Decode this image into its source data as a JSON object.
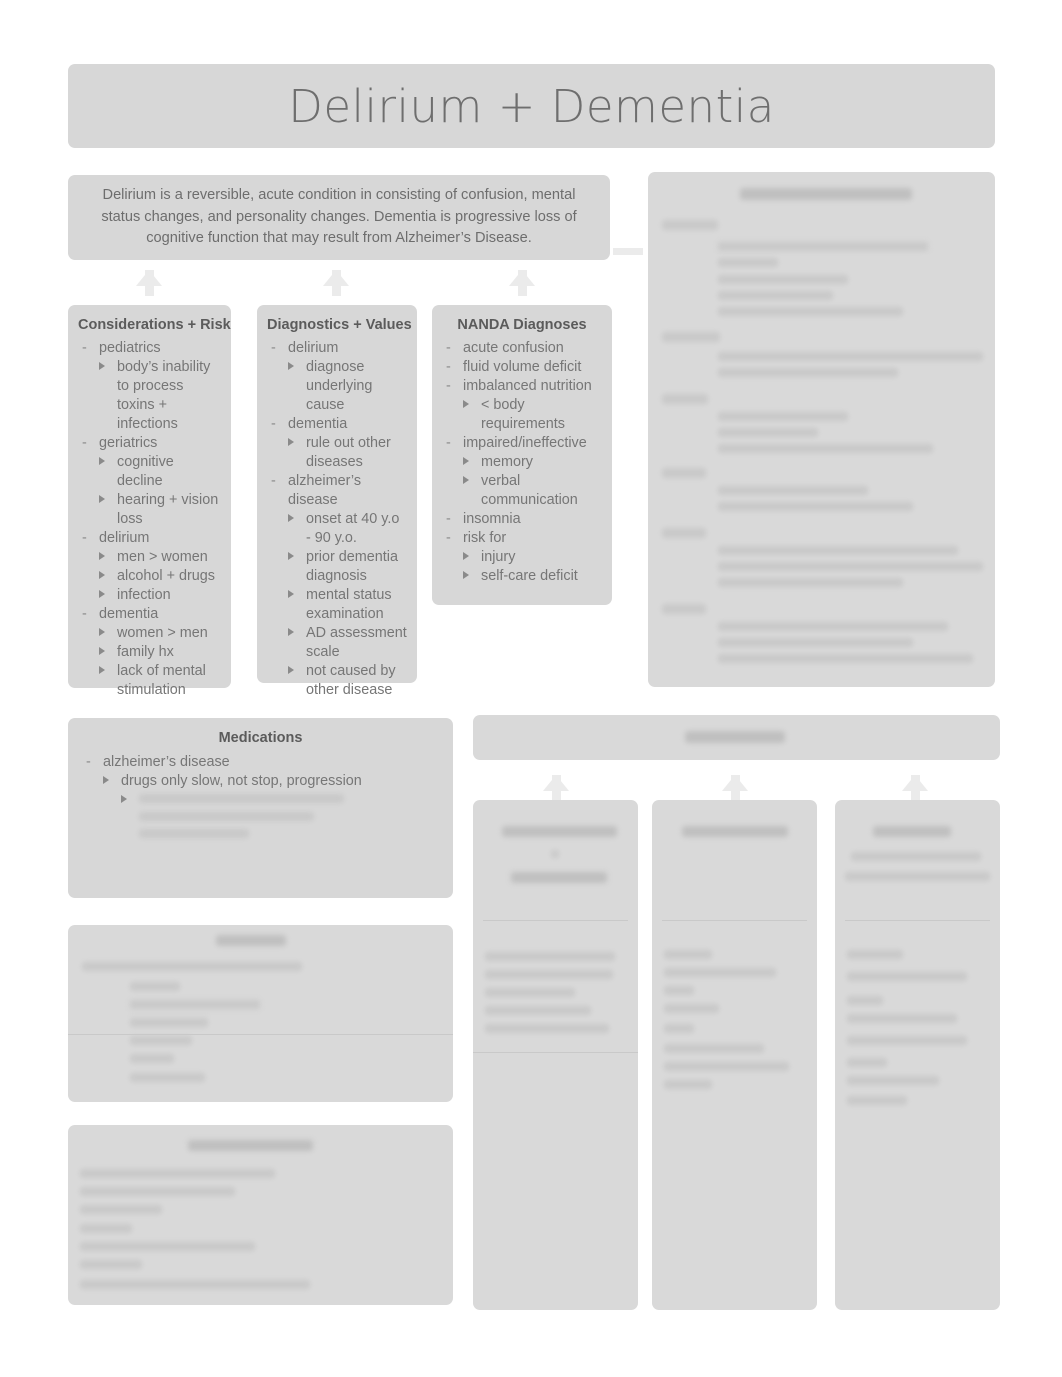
{
  "page": {
    "title": "Delirium + Dementia",
    "background_color": "#ffffff",
    "box_color": "#d7d7d7",
    "text_color": "#767676",
    "heading_color": "#5b5b5b"
  },
  "description": {
    "text": "Delirium is a reversible, acute condition in consisting of confusion, mental status changes, and personality changes. Dementia is progressive loss of cognitive function that may result from Alzheimer’s Disease."
  },
  "columns": [
    {
      "heading": "Considerations + Risk",
      "items": [
        {
          "label": "pediatrics",
          "children": [
            "body’s inability to process toxins + infections"
          ]
        },
        {
          "label": "geriatrics",
          "children": [
            "cognitive decline",
            "hearing + vision loss"
          ]
        },
        {
          "label": "delirium",
          "children": [
            "men > women",
            "alcohol + drugs",
            "infection"
          ]
        },
        {
          "label": "dementia",
          "children": [
            "women > men",
            "family hx",
            "lack of mental stimulation"
          ]
        }
      ]
    },
    {
      "heading": "Diagnostics + Values",
      "items": [
        {
          "label": "delirium",
          "children": [
            "diagnose underlying cause"
          ]
        },
        {
          "label": "dementia",
          "children": [
            "rule out other diseases"
          ]
        },
        {
          "label": "alzheimer’s disease",
          "children": [
            "onset at 40 y.o - 90 y.o.",
            "prior dementia diagnosis",
            "mental status examination",
            "AD assessment scale",
            "not caused by other disease"
          ]
        }
      ]
    },
    {
      "heading": "NANDA Diagnoses",
      "items": [
        {
          "label": "acute confusion",
          "children": []
        },
        {
          "label": "fluid volume deficit",
          "children": []
        },
        {
          "label": "imbalanced nutrition",
          "children": [
            "< body requirements"
          ]
        },
        {
          "label": "impaired/ineffective",
          "children": [
            "memory",
            "verbal communication"
          ]
        },
        {
          "label": "insomnia",
          "children": []
        },
        {
          "label": "risk for",
          "children": [
            "injury",
            "self-care deficit"
          ]
        }
      ]
    }
  ],
  "medications": {
    "heading": "Medications",
    "items": [
      {
        "label": "alzheimer’s disease",
        "children": [
          {
            "label": "drugs only slow, not stop, progression",
            "children": [
              "",
              "",
              ""
            ]
          }
        ]
      }
    ]
  },
  "redacted_panels": [
    {
      "name": "right-big-panel",
      "heading": "",
      "note": "illegible"
    },
    {
      "name": "pathology-box",
      "heading": "",
      "note": "illegible"
    },
    {
      "name": "patient-education-box",
      "heading": "",
      "note": "illegible"
    },
    {
      "name": "interventions-banner",
      "heading": "",
      "note": "illegible"
    },
    {
      "name": "intervention-column-1",
      "heading": "",
      "note": "illegible"
    },
    {
      "name": "intervention-column-2",
      "heading": "",
      "note": "illegible"
    },
    {
      "name": "intervention-column-3",
      "heading": "",
      "note": "illegible"
    }
  ]
}
